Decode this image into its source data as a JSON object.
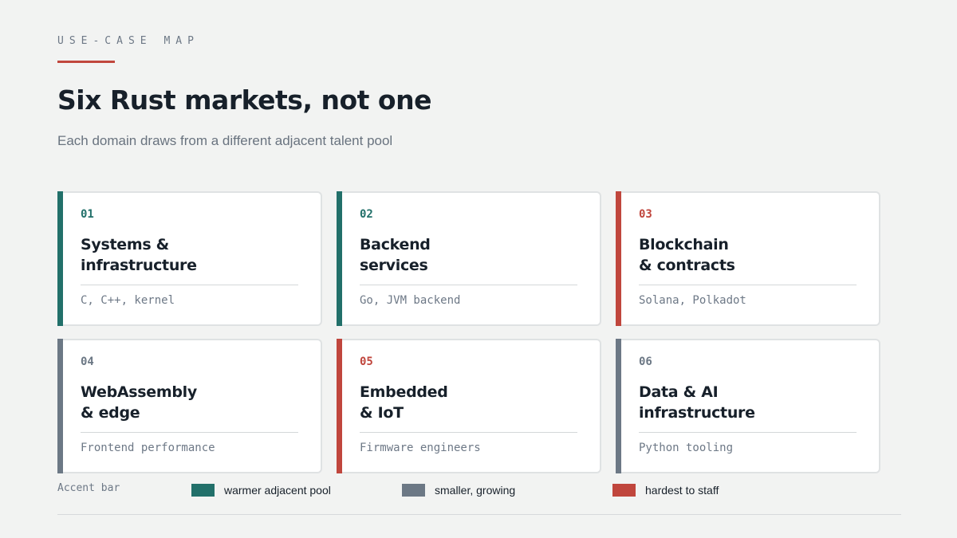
{
  "header": {
    "eyebrow": "USE-CASE MAP",
    "title": "Six Rust markets, not one",
    "subtitle": "Each domain draws from a different adjacent talent pool"
  },
  "colors": {
    "teal": "#22706a",
    "slate": "#6c7885",
    "red": "#c0463d",
    "eyebrow_rule": "#c0463d"
  },
  "cards": [
    {
      "number": "01",
      "title_line1": "Systems &",
      "title_line2": "infrastructure",
      "pool": "C, C++, kernel",
      "accent": "teal"
    },
    {
      "number": "02",
      "title_line1": "Backend",
      "title_line2": "services",
      "pool": "Go, JVM backend",
      "accent": "teal"
    },
    {
      "number": "03",
      "title_line1": "Blockchain",
      "title_line2": "& contracts",
      "pool": "Solana, Polkadot",
      "accent": "red"
    },
    {
      "number": "04",
      "title_line1": "WebAssembly",
      "title_line2": "& edge",
      "pool": "Frontend performance",
      "accent": "slate"
    },
    {
      "number": "05",
      "title_line1": "Embedded",
      "title_line2": "& IoT",
      "pool": "Firmware engineers",
      "accent": "red"
    },
    {
      "number": "06",
      "title_line1": "Data & AI",
      "title_line2": "infrastructure",
      "pool": "Python tooling",
      "accent": "slate"
    }
  ],
  "legend": {
    "label": "Accent bar",
    "items": [
      {
        "text": "warmer adjacent pool",
        "accent": "teal"
      },
      {
        "text": "smaller, growing",
        "accent": "slate"
      },
      {
        "text": "hardest to staff",
        "accent": "red"
      }
    ]
  }
}
